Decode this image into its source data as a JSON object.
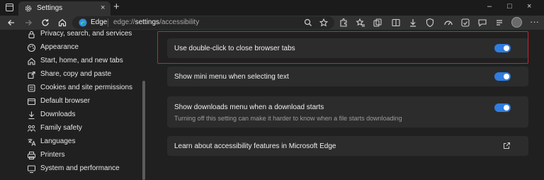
{
  "browser": {
    "tab_title": "Settings",
    "tab_close": "×",
    "new_tab": "+",
    "window_controls": [
      "–",
      "□",
      "×"
    ],
    "brand_label": "Edge",
    "url_prefix": "edge://",
    "url_bold": "settings",
    "url_suffix": "/accessibility",
    "more": "···"
  },
  "sidebar": {
    "items": [
      {
        "label": "Privacy, search, and services",
        "icon": "lock-icon"
      },
      {
        "label": "Appearance",
        "icon": "appearance-icon"
      },
      {
        "label": "Start, home, and new tabs",
        "icon": "home-icon"
      },
      {
        "label": "Share, copy and paste",
        "icon": "share-icon"
      },
      {
        "label": "Cookies and site permissions",
        "icon": "permissions-icon"
      },
      {
        "label": "Default browser",
        "icon": "default-browser-icon"
      },
      {
        "label": "Downloads",
        "icon": "download-icon"
      },
      {
        "label": "Family safety",
        "icon": "family-icon"
      },
      {
        "label": "Languages",
        "icon": "languages-icon"
      },
      {
        "label": "Printers",
        "icon": "printer-icon"
      },
      {
        "label": "System and performance",
        "icon": "system-icon"
      }
    ]
  },
  "settings": {
    "double_click": {
      "label": "Use double-click to close browser tabs",
      "enabled": true
    },
    "mini_menu": {
      "label": "Show mini menu when selecting text",
      "enabled": true
    },
    "downloads_menu": {
      "label": "Show downloads menu when a download starts",
      "description": "Turning off this setting can make it harder to know when a file starts downloading",
      "enabled": true
    },
    "learn_more": {
      "label": "Learn about accessibility features in Microsoft Edge"
    }
  },
  "colors": {
    "accent": "#2f7de0",
    "highlight": "#c8262c",
    "card": "#2c2c2c",
    "background": "#202020"
  }
}
